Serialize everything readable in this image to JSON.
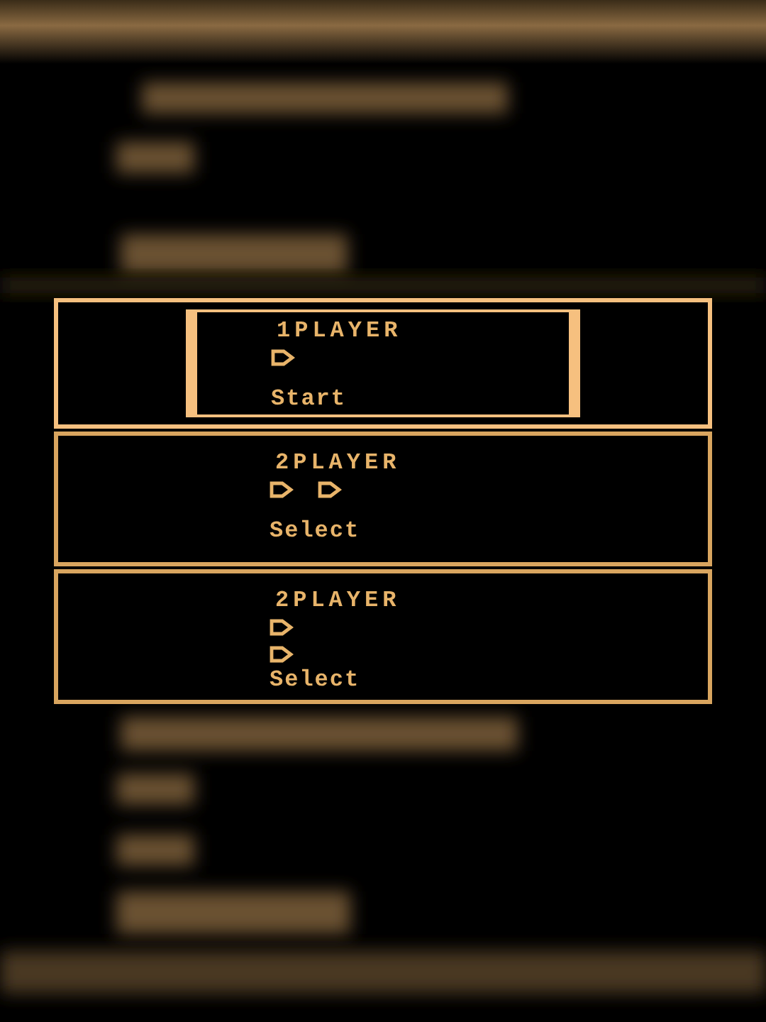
{
  "options": [
    {
      "title": "1PLAYER",
      "kind": "single",
      "action": "Start",
      "selected": true
    },
    {
      "title": "2PLAYER",
      "kind": "side_by_side",
      "action": "Select",
      "selected": false
    },
    {
      "title": "2PLAYER",
      "kind": "stacked",
      "action": "Select",
      "selected": false
    }
  ]
}
